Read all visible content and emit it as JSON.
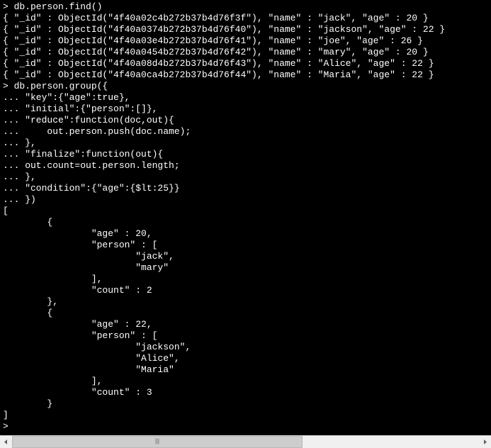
{
  "scroll": {
    "thumb_width": 410
  },
  "lines": [
    "> db.person.find()",
    "{ \"_id\" : ObjectId(\"4f40a02c4b272b37b4d76f3f\"), \"name\" : \"jack\", \"age\" : 20 }",
    "{ \"_id\" : ObjectId(\"4f40a0374b272b37b4d76f40\"), \"name\" : \"jackson\", \"age\" : 22 }",
    "{ \"_id\" : ObjectId(\"4f40a03e4b272b37b4d76f41\"), \"name\" : \"joe\", \"age\" : 26 }",
    "{ \"_id\" : ObjectId(\"4f40a0454b272b37b4d76f42\"), \"name\" : \"mary\", \"age\" : 20 }",
    "{ \"_id\" : ObjectId(\"4f40a08d4b272b37b4d76f43\"), \"name\" : \"Alice\", \"age\" : 22 }",
    "{ \"_id\" : ObjectId(\"4f40a0ca4b272b37b4d76f44\"), \"name\" : \"Maria\", \"age\" : 22 }",
    "> db.person.group({",
    "... \"key\":{\"age\":true},",
    "... \"initial\":{\"person\":[]},",
    "... \"reduce\":function(doc,out){",
    "...     out.person.push(doc.name);",
    "... },",
    "... \"finalize\":function(out){",
    "... out.count=out.person.length;",
    "... },",
    "... \"condition\":{\"age\":{$lt:25}}",
    "... })",
    "[",
    "        {",
    "                \"age\" : 20,",
    "                \"person\" : [",
    "                        \"jack\",",
    "                        \"mary\"",
    "                ],",
    "                \"count\" : 2",
    "        },",
    "        {",
    "                \"age\" : 22,",
    "                \"person\" : [",
    "                        \"jackson\",",
    "                        \"Alice\",",
    "                        \"Maria\"",
    "                ],",
    "                \"count\" : 3",
    "        }",
    "]",
    "> "
  ]
}
